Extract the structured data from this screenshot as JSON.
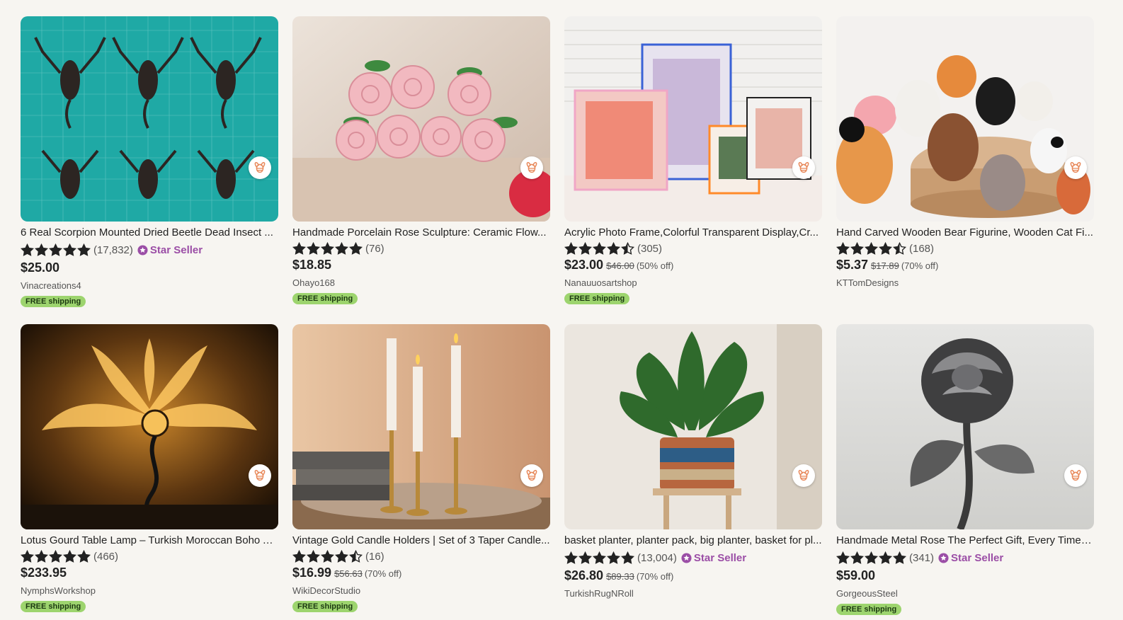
{
  "listings": [
    {
      "title": "6 Real Scorpion Mounted Dried Beetle Dead Insect ...",
      "reviews": "(17,832)",
      "star_seller": "Star Seller",
      "price": "$25.00",
      "original": "",
      "discount": "",
      "shop": "Vinacreations4",
      "shipping": "FREE shipping",
      "image": "scorpions-on-cutting-mat"
    },
    {
      "title": "Handmade Porcelain Rose Sculpture: Ceramic Flow...",
      "reviews": "(76)",
      "star_seller": "",
      "price": "$18.85",
      "original": "",
      "discount": "",
      "shop": "Ohayo168",
      "shipping": "FREE shipping",
      "image": "pink-porcelain-roses"
    },
    {
      "title": "Acrylic Photo Frame,Colorful Transparent Display,Cr...",
      "reviews": "(305)",
      "star_seller": "",
      "price": "$23.00",
      "original": "$46.00",
      "discount": "(50% off)",
      "shop": "Nanauuosartshop",
      "shipping": "FREE shipping",
      "image": "acrylic-photo-frames"
    },
    {
      "title": "Hand Carved Wooden Bear Figurine, Wooden Cat Fi...",
      "reviews": "(168)",
      "star_seller": "",
      "price": "$5.37",
      "original": "$17.89",
      "discount": "(70% off)",
      "shop": "KTTomDesigns",
      "shipping": "",
      "image": "wooden-animal-figurines"
    },
    {
      "title": "Lotus Gourd Table Lamp – Turkish Moroccan Boho A...",
      "reviews": "(466)",
      "star_seller": "",
      "price": "$233.95",
      "original": "",
      "discount": "",
      "shop": "NymphsWorkshop",
      "shipping": "FREE shipping",
      "image": "lotus-gourd-lamp"
    },
    {
      "title": "Vintage Gold Candle Holders | Set of 3 Taper Candle...",
      "reviews": "(16)",
      "star_seller": "",
      "price": "$16.99",
      "original": "$56.63",
      "discount": "(70% off)",
      "shop": "WikiDecorStudio",
      "shipping": "FREE shipping",
      "image": "gold-candle-holders"
    },
    {
      "title": "basket planter, planter pack, big planter, basket for pl...",
      "reviews": "(13,004)",
      "star_seller": "Star Seller",
      "price": "$26.80",
      "original": "$89.33",
      "discount": "(70% off)",
      "shop": "TurkishRugNRoll",
      "shipping": "",
      "image": "monstera-basket-planter"
    },
    {
      "title": "Handmade Metal Rose The Perfect Gift, Every Time. ...",
      "reviews": "(341)",
      "star_seller": "Star Seller",
      "price": "$59.00",
      "original": "",
      "discount": "",
      "shop": "GorgeousSteel",
      "shipping": "FREE shipping",
      "image": "metal-rose"
    }
  ],
  "ratings": [
    5,
    5,
    4.5,
    4.5,
    5,
    4.5,
    5,
    5
  ],
  "colors": {
    "background": "#f7f5f1",
    "free_shipping_badge": "#9dd46e",
    "star_seller": "#9b4ea6"
  },
  "icons": {
    "favorite": "bee-heart-icon",
    "star": "star-icon",
    "star_seller_badge": "star-seller-badge-icon"
  }
}
